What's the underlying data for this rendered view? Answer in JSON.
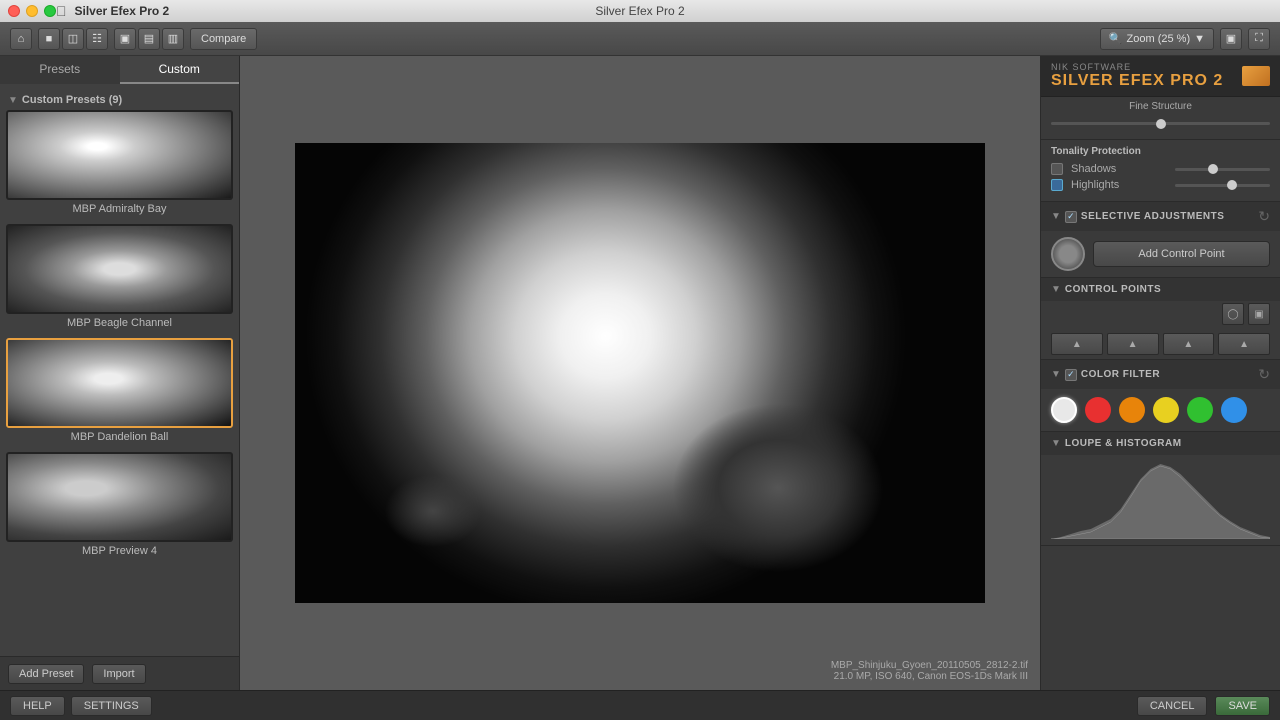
{
  "titleBar": {
    "appName": "Silver Efex Pro 2",
    "windowTitle": "Silver Efex Pro 2"
  },
  "toolbar": {
    "compareLabel": "Compare",
    "zoomLabel": "Zoom (25 %)"
  },
  "leftPanel": {
    "tabs": [
      {
        "id": "presets",
        "label": "Presets"
      },
      {
        "id": "custom",
        "label": "Custom"
      }
    ],
    "activeTab": "custom",
    "sectionTitle": "Custom Presets (9)",
    "presets": [
      {
        "id": 1,
        "name": "MBP Admiralty Bay",
        "active": false
      },
      {
        "id": 2,
        "name": "MBP Beagle Channel",
        "active": false
      },
      {
        "id": 3,
        "name": "MBP Dandelion Ball",
        "active": true
      },
      {
        "id": 4,
        "name": "MBP Preview 4",
        "active": false
      }
    ],
    "addPresetLabel": "Add Preset",
    "importLabel": "Import"
  },
  "imageInfo": {
    "filename": "MBP_Shinjuku_Gyoen_20110505_2812-2.tif",
    "details": "21.0 MP, ISO 640, Canon EOS-1Ds Mark III"
  },
  "rightPanel": {
    "nikBrand": "Nik Software",
    "nikTitle": "SILVER EFEX PRO",
    "nikTitleAccent": "2",
    "fineStructureLabel": "Fine Structure",
    "tonalityProtection": {
      "title": "Tonality Protection",
      "shadowsLabel": "Shadows",
      "highlightsLabel": "Highlights"
    },
    "selectiveAdjustments": {
      "title": "SELECTIVE ADJUSTMENTS",
      "addControlPointLabel": "Add Control Point"
    },
    "controlPoints": {
      "title": "Control Points"
    },
    "colorFilter": {
      "title": "COLOR FILTER",
      "colors": [
        {
          "id": "white",
          "color": "#e8e8e8",
          "selected": true
        },
        {
          "id": "red",
          "color": "#e83030"
        },
        {
          "id": "orange",
          "color": "#e8840a"
        },
        {
          "id": "yellow",
          "color": "#e8d020"
        },
        {
          "id": "green",
          "color": "#30c030"
        },
        {
          "id": "blue",
          "color": "#3090e8"
        }
      ]
    },
    "loupeHistogram": {
      "title": "LOUPE & HISTOGRAM"
    }
  },
  "bottomBar": {
    "helpLabel": "HELP",
    "settingsLabel": "SETTINGS",
    "cancelLabel": "CANCEL",
    "saveLabel": "SAVE"
  }
}
